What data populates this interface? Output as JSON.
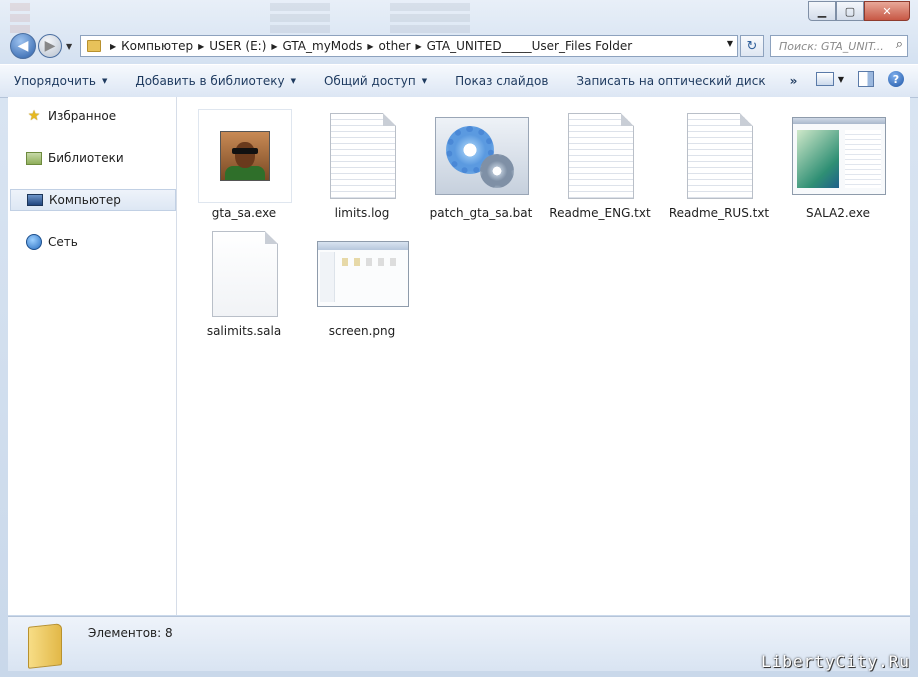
{
  "window": {
    "caption_buttons": {
      "minimize": "▁",
      "maximize": "▢",
      "close": "✕"
    }
  },
  "nav": {
    "back": "◀",
    "forward": "▶",
    "recent": "▼"
  },
  "address": {
    "crumbs": [
      "Компьютер",
      "USER (E:)",
      "GTA_myMods",
      "other",
      "GTA_UNITED_____User_Files Folder"
    ],
    "separator": "▶",
    "dropdown": "▼"
  },
  "refresh": {
    "glyph": "↻"
  },
  "search": {
    "placeholder": "Поиск: GTA_UNIT...",
    "icon": "⌕"
  },
  "toolbar": {
    "organize": "Упорядочить",
    "library": "Добавить в библиотеку",
    "share": "Общий доступ",
    "slideshow": "Показ слайдов",
    "burn": "Записать на оптический диск",
    "more": "»",
    "arrow": "▼",
    "view_arrow": "▼",
    "help": "?"
  },
  "sidebar": {
    "items": [
      {
        "label": "Избранное",
        "icon": "star-icon"
      },
      {
        "label": "Библиотеки",
        "icon": "libraries-icon"
      },
      {
        "label": "Компьютер",
        "icon": "computer-icon",
        "selected": true
      },
      {
        "label": "Сеть",
        "icon": "network-icon"
      }
    ],
    "star_glyph": "★"
  },
  "files": [
    {
      "name": "gta_sa.exe",
      "type": "exe-avatar",
      "selected": true
    },
    {
      "name": "limits.log",
      "type": "text"
    },
    {
      "name": "patch_gta_sa.bat",
      "type": "batch"
    },
    {
      "name": "Readme_ENG.txt",
      "type": "text"
    },
    {
      "name": "Readme_RUS.txt",
      "type": "text"
    },
    {
      "name": "SALA2.exe",
      "type": "exe-window"
    },
    {
      "name": "salimits.sala",
      "type": "blank"
    },
    {
      "name": "screen.png",
      "type": "image"
    }
  ],
  "status": {
    "count_text": "Элементов: 8"
  },
  "watermark": {
    "text": "LibertyCity.Ru"
  },
  "colors": {
    "chrome": "#cfdceb",
    "toolbar_text": "#1e3a5f",
    "accent": "#2b5fa8"
  }
}
